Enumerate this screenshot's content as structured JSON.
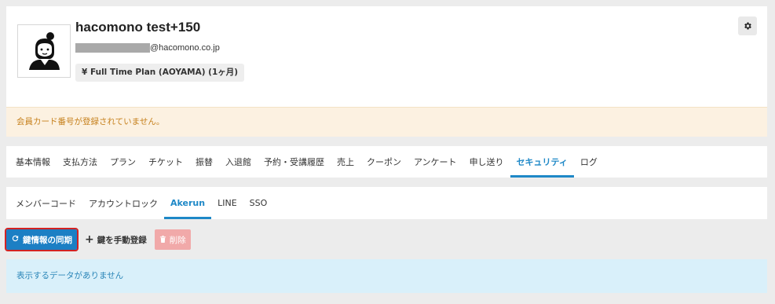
{
  "member": {
    "name": "hacomono test+150",
    "email_domain": "@hacomono.co.jp",
    "plan": "¥ Full Time Plan (AOYAMA) (1ヶ月)"
  },
  "alert": {
    "warning": "会員カード番号が登録されていません。",
    "info": "表示するデータがありません"
  },
  "main_tabs": [
    {
      "label": "基本情報"
    },
    {
      "label": "支払方法"
    },
    {
      "label": "プラン"
    },
    {
      "label": "チケット"
    },
    {
      "label": "振替"
    },
    {
      "label": "入退館"
    },
    {
      "label": "予約・受講履歴"
    },
    {
      "label": "売上"
    },
    {
      "label": "クーポン"
    },
    {
      "label": "アンケート"
    },
    {
      "label": "申し送り"
    },
    {
      "label": "セキュリティ",
      "active": true
    },
    {
      "label": "ログ"
    }
  ],
  "sub_tabs": [
    {
      "label": "メンバーコード"
    },
    {
      "label": "アカウントロック"
    },
    {
      "label": "Akerun",
      "active": true
    },
    {
      "label": "LINE"
    },
    {
      "label": "SSO"
    }
  ],
  "toolbar": {
    "sync_label": "鍵情報の同期",
    "add_label": "鍵を手動登録",
    "delete_label": "削除"
  },
  "icons": {
    "settings": "gear-icon",
    "sync": "refresh-icon",
    "add": "plus-icon",
    "delete": "trash-icon",
    "avatar": "user-avatar-icon"
  },
  "colors": {
    "accent": "#1e88c7",
    "warning_bg": "#fcf1e1",
    "warning_text": "#c6801c",
    "info_bg": "#d9f0fa",
    "info_text": "#2b86b8",
    "danger_light": "#f1a9a9",
    "highlight": "#d32222"
  }
}
